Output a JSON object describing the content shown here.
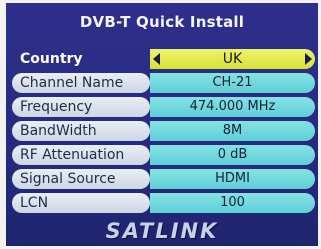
{
  "title": "DVB-T Quick Install",
  "rows": [
    {
      "label": "Country",
      "value": "UK"
    },
    {
      "label": "Channel Name",
      "value": "CH-21"
    },
    {
      "label": "Frequency",
      "value": "474.000 MHz"
    },
    {
      "label": "BandWidth",
      "value": "8M"
    },
    {
      "label": "RF Attenuation",
      "value": "0 dB"
    },
    {
      "label": "Signal Source",
      "value": "HDMI"
    },
    {
      "label": "LCN",
      "value": "100"
    }
  ],
  "logo": "SATLINK",
  "colors": {
    "background": "#262a7e",
    "selected_value": "#e2e84a",
    "value_cell": "#6fd8dd",
    "label_cell": "#dbe2ec"
  }
}
